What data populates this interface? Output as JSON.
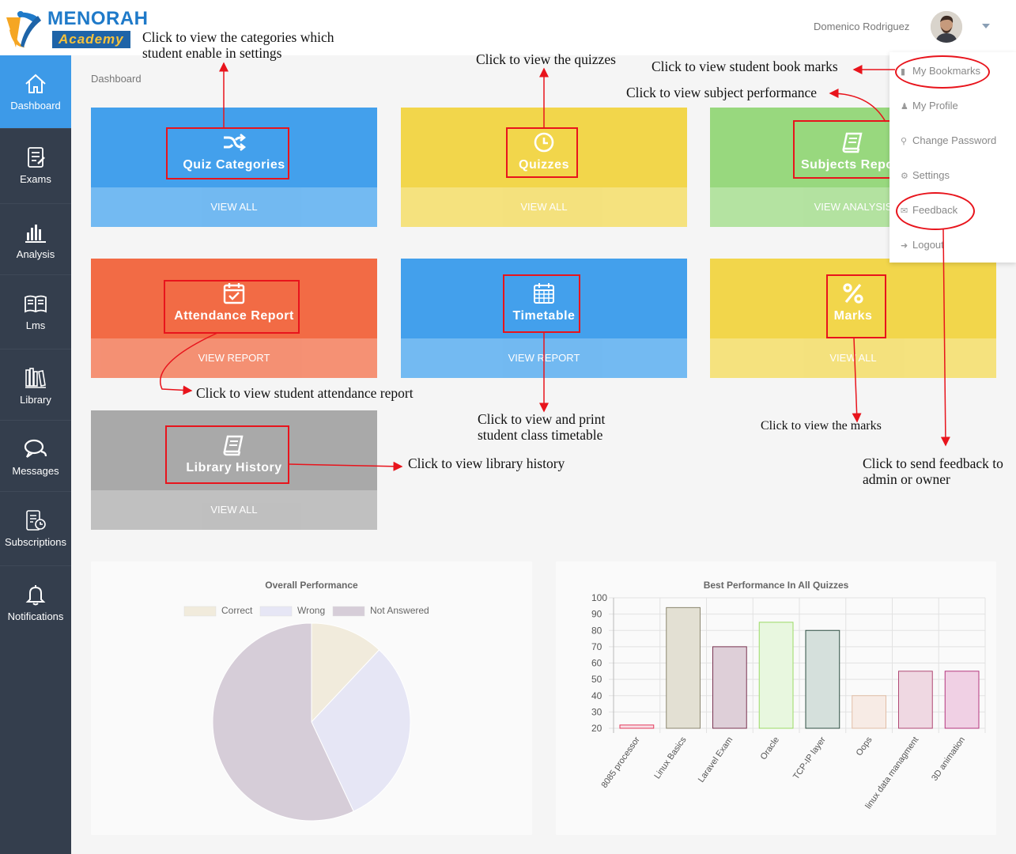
{
  "brand": {
    "name": "MENORAH",
    "sub": "Academy"
  },
  "user": {
    "name": "Domenico Rodriguez"
  },
  "breadcrumb": "Dashboard",
  "sidebar": [
    {
      "label": "Dashboard",
      "icon": "home-icon"
    },
    {
      "label": "Exams",
      "icon": "exam-icon"
    },
    {
      "label": "Analysis",
      "icon": "bar-chart-icon"
    },
    {
      "label": "Lms",
      "icon": "book-open-icon"
    },
    {
      "label": "Library",
      "icon": "library-icon"
    },
    {
      "label": "Messages",
      "icon": "chat-icon"
    },
    {
      "label": "Subscriptions",
      "icon": "subscription-icon"
    },
    {
      "label": "Notifications",
      "icon": "bell-icon"
    }
  ],
  "tiles": [
    {
      "title": "Quiz Categories",
      "action": "VIEW ALL",
      "color": "#43a0ec",
      "color2": "#6cb6f1",
      "icon": "shuffle-icon"
    },
    {
      "title": "Quizzes",
      "action": "VIEW ALL",
      "color": "#f2d64b",
      "color2": "#f4e077",
      "icon": "clock-icon"
    },
    {
      "title": "Subjects Repo",
      "action": "VIEW ANALYSIS",
      "color": "#98d87e",
      "color2": "#b0e19c",
      "icon": "book-icon"
    },
    {
      "title": "Attendance Report",
      "action": "VIEW REPORT",
      "color": "#f26b45",
      "color2": "#f48b6d",
      "icon": "calendar-check-icon"
    },
    {
      "title": "Timetable",
      "action": "VIEW REPORT",
      "color": "#43a0ec",
      "color2": "#6cb6f1",
      "icon": "calendar-grid-icon"
    },
    {
      "title": "Marks",
      "action": "VIEW ALL",
      "color": "#f2d64b",
      "color2": "#f4e077",
      "icon": "percent-icon"
    },
    {
      "title": "Library History",
      "action": "VIEW ALL",
      "color": "#a9a9a9",
      "color2": "#bdbdbd",
      "icon": "book-icon"
    }
  ],
  "menu": [
    {
      "label": "My Bookmarks",
      "icon": "bookmark-icon"
    },
    {
      "label": "My Profile",
      "icon": "user-icon"
    },
    {
      "label": "Change Password",
      "icon": "key-icon"
    },
    {
      "label": "Settings",
      "icon": "gear-icon"
    },
    {
      "label": "Feedback",
      "icon": "comment-icon"
    },
    {
      "label": "Logout",
      "icon": "logout-icon"
    }
  ],
  "annotations": [
    "Click to view the categories which",
    "student enable in settings",
    "Click to view the quizzes",
    "Click to view student book marks",
    "Click to view subject performance",
    "Click to view student attendance report",
    "Click to view and print",
    "student class timetable",
    "Click to view the marks",
    "Click to view library history",
    "Click to send feedback to",
    "admin or owner"
  ],
  "chart_data": [
    {
      "type": "pie",
      "title": "Overall Performance",
      "labels": [
        "Correct",
        "Wrong",
        "Not Answered"
      ],
      "values": [
        12,
        31,
        57
      ],
      "colors": [
        "#f1ebdc",
        "#e6e6f5",
        "#d6cdd8"
      ]
    },
    {
      "type": "bar",
      "title": "Best Performance In All Quizzes",
      "categories": [
        "8085 processor",
        "Linux Basics",
        "Laravel Exam",
        "Oracle",
        "TCP-IP layer",
        "Oops",
        "linux data managment",
        "3D animation"
      ],
      "values": [
        22,
        94,
        70,
        85,
        80,
        40,
        55,
        55
      ],
      "ylim": [
        20,
        100
      ],
      "yticks": [
        20,
        30,
        40,
        50,
        60,
        70,
        80,
        90,
        100
      ],
      "fills": [
        "#f7dfe5",
        "#e3e0d3",
        "#decfd8",
        "#e8f7df",
        "#d5e0dc",
        "#f7ebe5",
        "#efd8e2",
        "#f0d0e4"
      ],
      "strokes": [
        "#e33a5c",
        "#8c8770",
        "#7a3552",
        "#9bdb66",
        "#2f4f43",
        "#e1bda6",
        "#b04875",
        "#b4367e"
      ],
      "grid": true
    }
  ]
}
